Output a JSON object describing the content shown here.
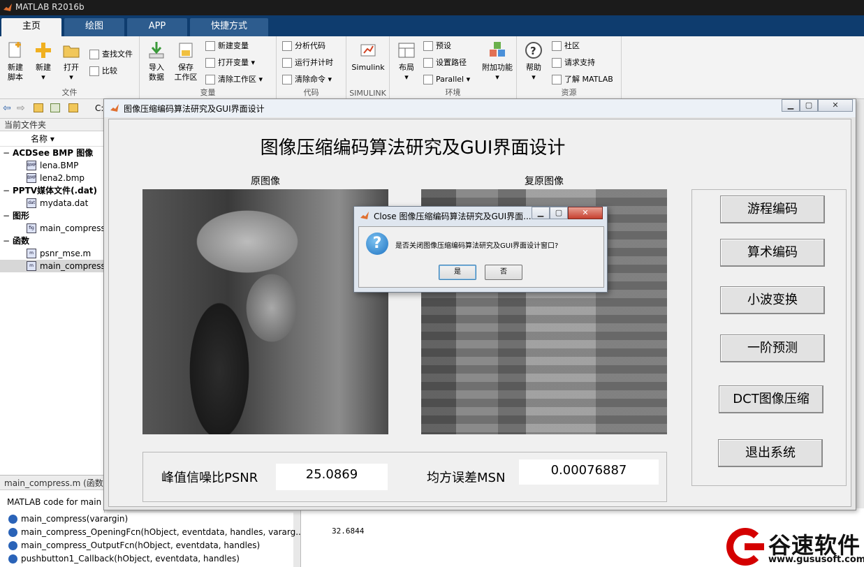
{
  "app": {
    "title": "MATLAB R2016b"
  },
  "tabs": [
    "主页",
    "绘图",
    "APP",
    "快捷方式"
  ],
  "ribbon": {
    "file": {
      "new_script": "新建\n脚本",
      "new": "新建",
      "open": "打开",
      "find_files": "查找文件",
      "compare": "比较",
      "group": "文件"
    },
    "variable": {
      "import": "导入\n数据",
      "save_ws": "保存\n工作区",
      "new_var": "新建变量",
      "open_var": "打开变量",
      "clear_ws": "清除工作区",
      "group": "变量"
    },
    "code": {
      "analyze": "分析代码",
      "run_time": "运行并计时",
      "clear_cmd": "清除命令",
      "group": "代码"
    },
    "simulink": {
      "label": "Simulink",
      "group": "SIMULINK"
    },
    "env": {
      "layout": "布局",
      "prefs": "预设",
      "set_path": "设置路径",
      "parallel": "Parallel",
      "addons": "附加功能",
      "group": "环境"
    },
    "resources": {
      "help": "帮助",
      "community": "社区",
      "support": "请求支持",
      "learn": "了解 MATLAB",
      "group": "资源"
    }
  },
  "address": {
    "path": "C:"
  },
  "current_folder": {
    "header": "当前文件夹",
    "column": "名称",
    "groups": [
      {
        "name": "ACDSee BMP 图像",
        "files": [
          {
            "name": "lena.BMP",
            "icon": "BMP"
          },
          {
            "name": "lena2.bmp",
            "icon": "BMP"
          }
        ]
      },
      {
        "name": "PPTV媒体文件(.dat)",
        "files": [
          {
            "name": "mydata.dat",
            "icon": "dat"
          }
        ]
      },
      {
        "name": "图形",
        "files": [
          {
            "name": "main_compress",
            "icon": "fig"
          }
        ]
      },
      {
        "name": "函数",
        "files": [
          {
            "name": "psnr_mse.m",
            "icon": "m"
          },
          {
            "name": "main_compress",
            "icon": "m",
            "selected": true
          }
        ]
      }
    ],
    "details_header": "main_compress.m  (函数)",
    "details_desc": "MATLAB code for main"
  },
  "function_list": [
    "main_compress(varargin)",
    "main_compress_OpeningFcn(hObject, eventdata, handles, vararg...",
    "main_compress_OutputFcn(hObject, eventdata, handles)",
    "pushbutton1_Callback(hObject, eventdata, handles)"
  ],
  "command_window": {
    "value": "32.6844"
  },
  "gui": {
    "window_title": "图像压缩编码算法研究及GUI界面设计",
    "heading": "图像压缩编码算法研究及GUI界面设计",
    "original_label": "原图像",
    "restored_label": "复原图像",
    "buttons": [
      "游程编码",
      "算术编码",
      "小波变换",
      "一阶预测",
      "DCT图像压缩",
      "退出系统"
    ],
    "psnr_label": "峰值信噪比PSNR",
    "psnr_value": "25.0869",
    "mse_label": "均方误差MSN",
    "mse_value": "0.00076887"
  },
  "dialog": {
    "title": "Close 图像压缩编码算法研究及GUI界面...",
    "message": "是否关闭图像压缩编码算法研究及GUI界面设计窗口?",
    "yes": "是",
    "no": "否"
  },
  "watermark": {
    "name": "谷速软件",
    "url": "www.gususoft.com"
  },
  "colors": {
    "accent_dark": "#0e3c6e",
    "tab_active": "#f3f3f3",
    "brand_red": "#d40000"
  }
}
